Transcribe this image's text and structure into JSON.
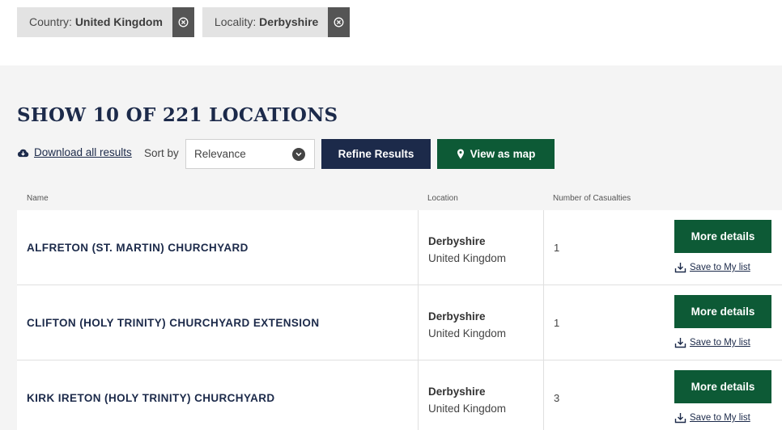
{
  "filters": [
    {
      "key": "Country:",
      "value": "United Kingdom"
    },
    {
      "key": "Locality:",
      "value": "Derbyshire"
    }
  ],
  "heading": "SHOW 10 OF 221 LOCATIONS",
  "toolbar": {
    "download_label": "Download all results",
    "sort_label": "Sort by",
    "sort_value": "Relevance",
    "refine_label": "Refine Results",
    "map_label": "View as map"
  },
  "columns": {
    "name": "Name",
    "location": "Location",
    "casualties": "Number of Casualties"
  },
  "rows": [
    {
      "name": "ALFRETON (ST. MARTIN) CHURCHYARD",
      "county": "Derbyshire",
      "country": "United Kingdom",
      "casualties": "1",
      "more": "More details",
      "save": "Save to My list"
    },
    {
      "name": "CLIFTON (HOLY TRINITY) CHURCHYARD EXTENSION",
      "county": "Derbyshire",
      "country": "United Kingdom",
      "casualties": "1",
      "more": "More details",
      "save": "Save to My list"
    },
    {
      "name": "KIRK IRETON (HOLY TRINITY) CHURCHYARD",
      "county": "Derbyshire",
      "country": "United Kingdom",
      "casualties": "3",
      "more": "More details",
      "save": "Save to My list"
    }
  ],
  "icons": {
    "chip_close": "close-circle-icon",
    "download": "cloud-download-icon",
    "select": "chevron-down-icon",
    "map": "map-pin-icon",
    "save": "save-download-icon"
  },
  "colors": {
    "navy": "#1c2a4a",
    "green": "#0d5a36",
    "chip_bg": "#e3e3e3",
    "chip_close_bg": "#555555",
    "page_bg": "#f4f4f4"
  }
}
